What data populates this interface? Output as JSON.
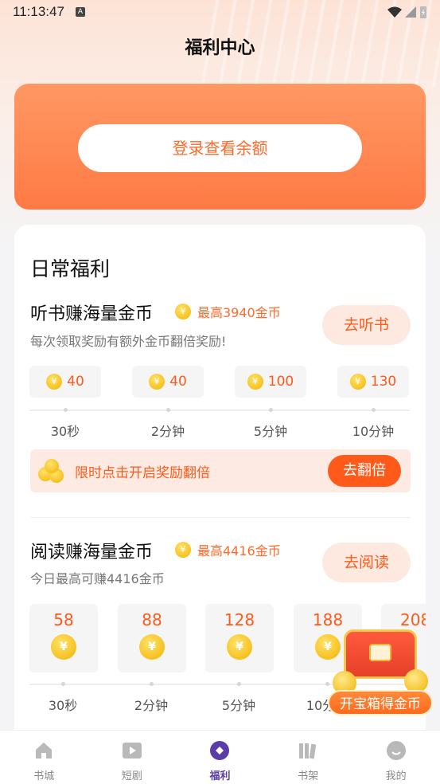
{
  "status": {
    "time": "11:13:47",
    "notif": "A"
  },
  "header": {
    "title": "福利中心"
  },
  "login": {
    "button_label": "登录查看余额"
  },
  "daily": {
    "title": "日常福利",
    "listen": {
      "title": "听书赚海量金币",
      "max": "最高3940金币",
      "subtitle": "每次领取奖励有额外金币翻倍奖励!",
      "button": "去听书",
      "stages": [
        {
          "coins": "40",
          "label": "30秒"
        },
        {
          "coins": "40",
          "label": "2分钟"
        },
        {
          "coins": "100",
          "label": "5分钟"
        },
        {
          "coins": "130",
          "label": "10分钟"
        }
      ],
      "double_text": "限时点击开启奖励翻倍",
      "double_button": "去翻倍"
    },
    "read": {
      "title": "阅读赚海量金币",
      "max": "最高4416金币",
      "subtitle": "今日最高可赚4416金币",
      "button": "去阅读",
      "stages": [
        {
          "coins": "58",
          "label": "30秒"
        },
        {
          "coins": "88",
          "label": "2分钟"
        },
        {
          "coins": "128",
          "label": "5分钟"
        },
        {
          "coins": "188",
          "label": "10分钟"
        },
        {
          "coins": "208",
          "label": ""
        }
      ]
    }
  },
  "treasure": {
    "label": "开宝箱得金币"
  },
  "tabs": [
    {
      "label": "书城"
    },
    {
      "label": "短剧"
    },
    {
      "label": "福利"
    },
    {
      "label": "书架"
    },
    {
      "label": "我的"
    }
  ],
  "colors": {
    "accent": "#ff6a2a",
    "tab_active": "#5a3da8"
  }
}
